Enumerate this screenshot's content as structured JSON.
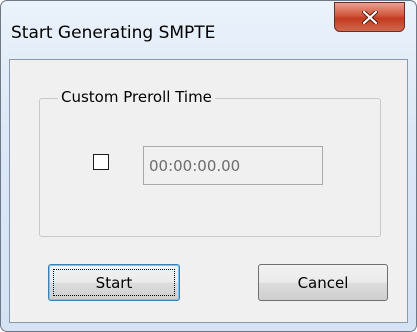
{
  "window": {
    "title": "Start Generating SMPTE",
    "close_icon": "close-icon"
  },
  "group": {
    "label": "Custom Preroll Time",
    "checkbox_checked": false,
    "time_value": "00:00:00.00"
  },
  "buttons": {
    "start_label": "Start",
    "cancel_label": "Cancel"
  },
  "colors": {
    "close_button": "#c7432a",
    "dialog_face": "#f0f0f0",
    "frame": "#dce8f6"
  }
}
